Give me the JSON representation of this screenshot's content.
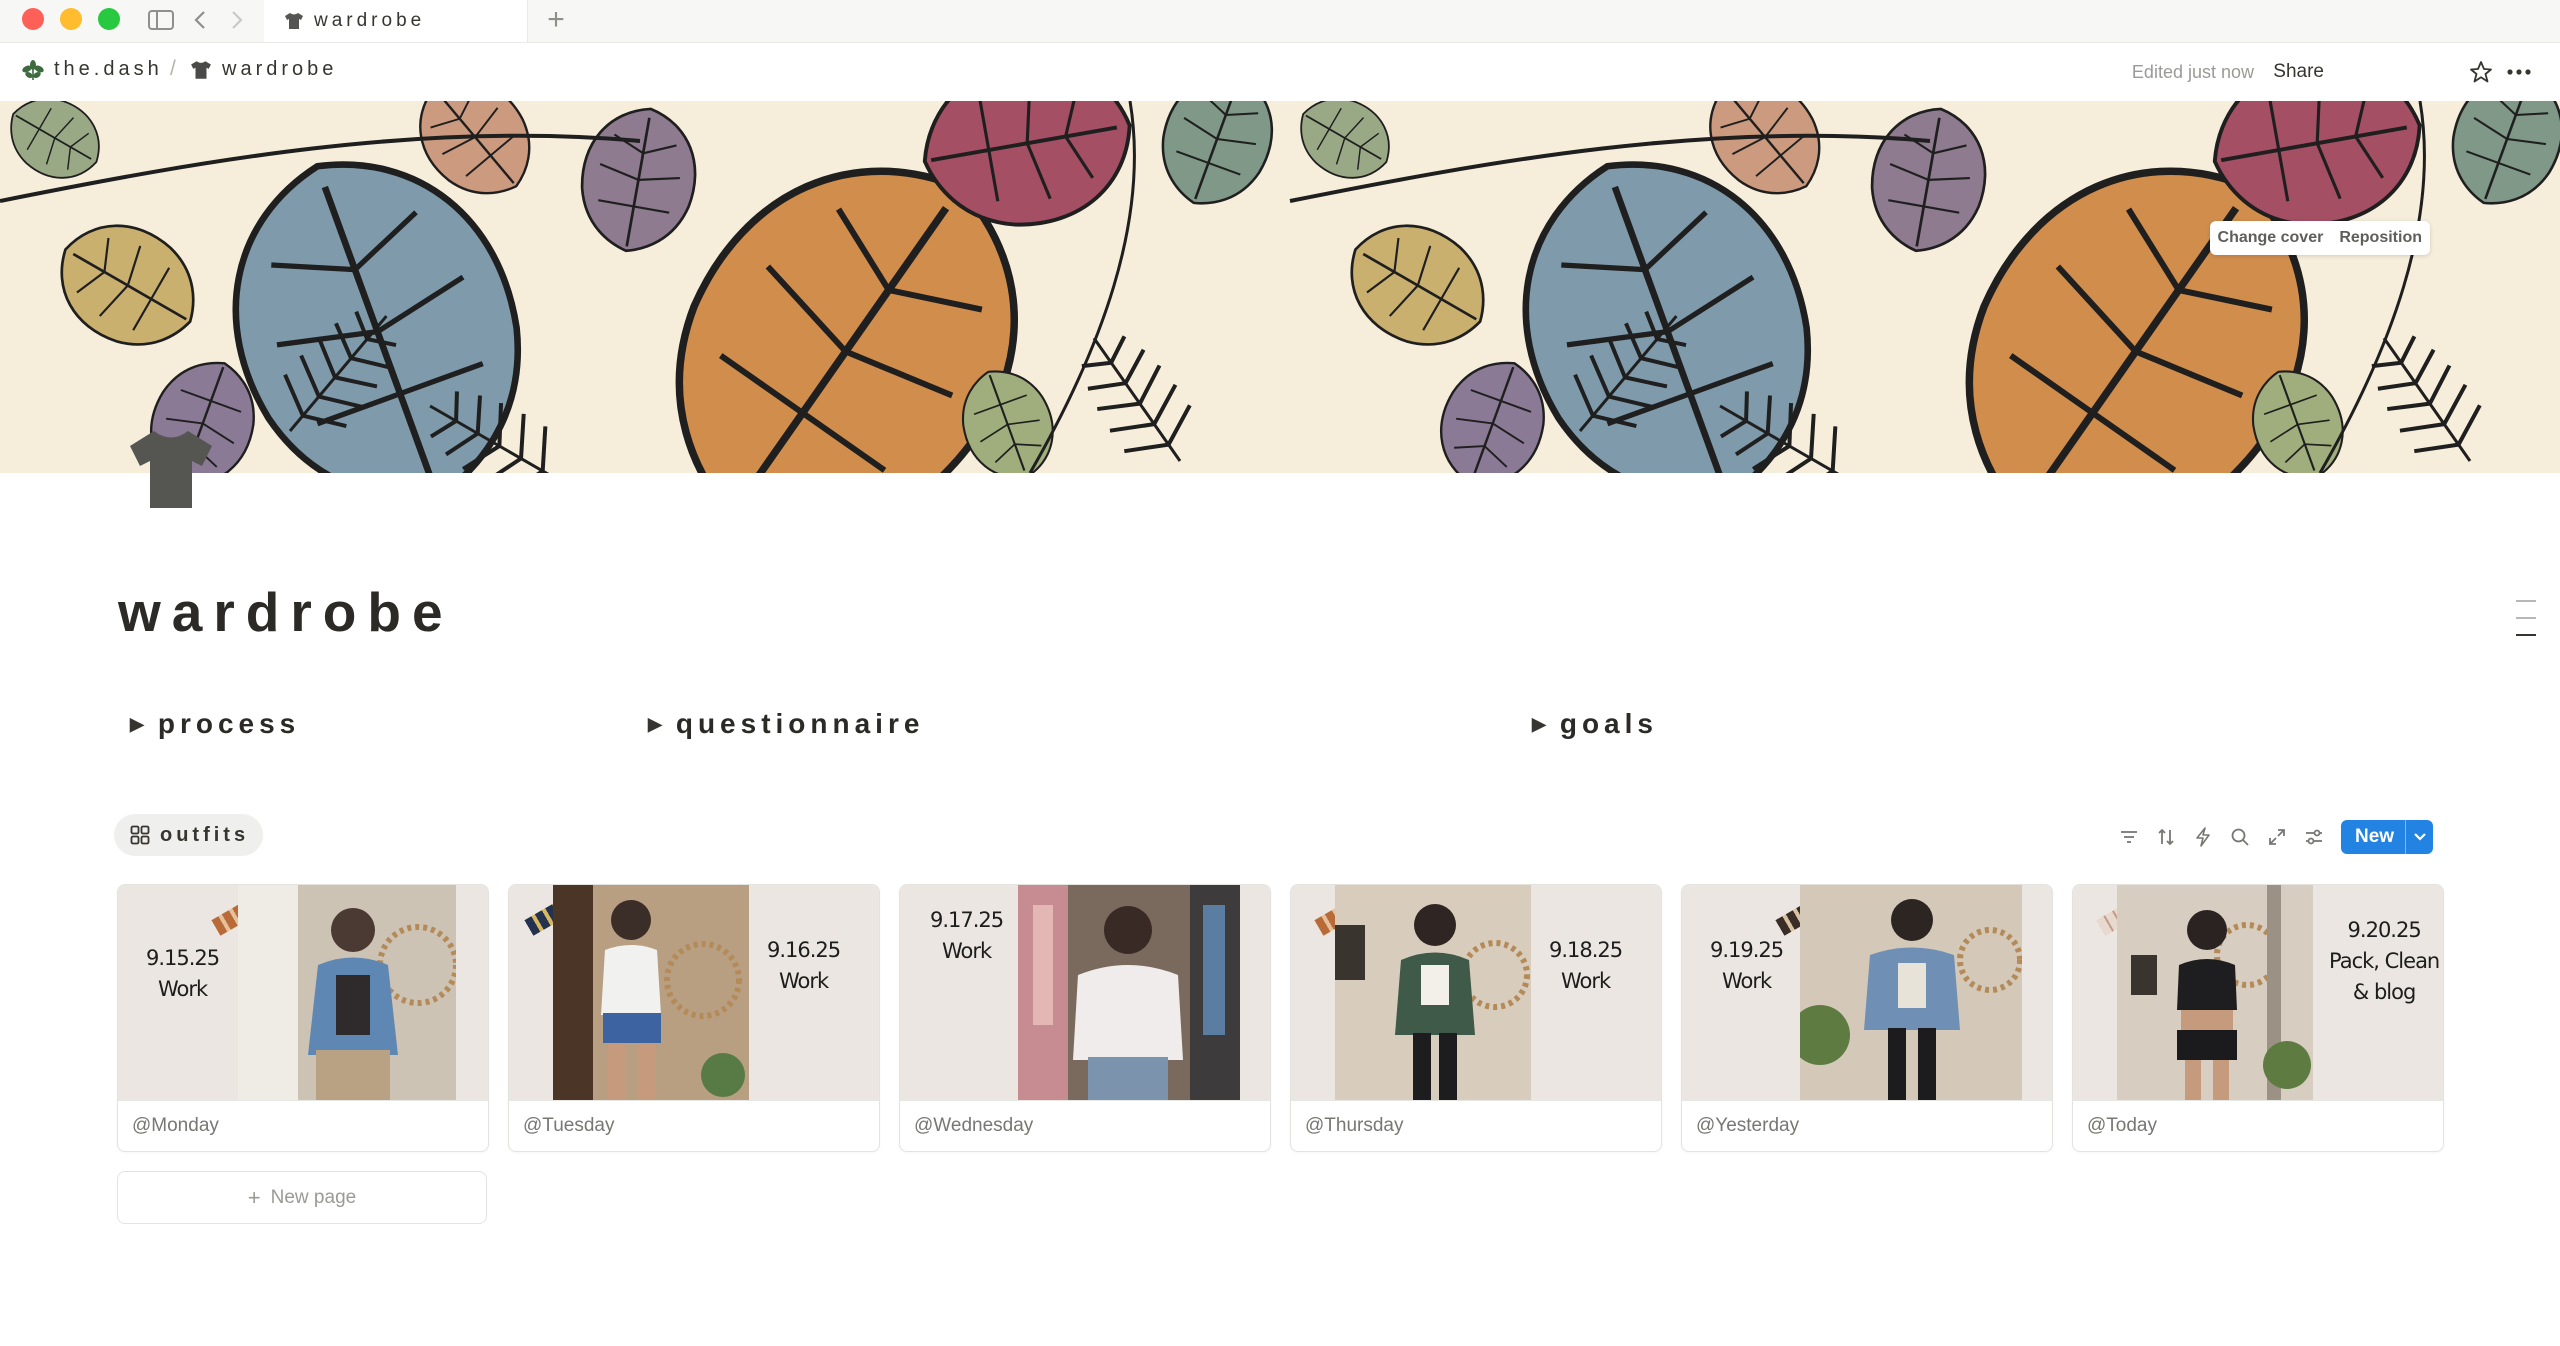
{
  "browser": {
    "tab_title": "wardrobe"
  },
  "topbar": {
    "breadcrumbs": [
      {
        "label": "the.dash",
        "icon": "plant-icon"
      },
      {
        "label": "wardrobe",
        "icon": "tshirt-icon"
      }
    ],
    "separator": "/",
    "edited": "Edited just now",
    "share": "Share"
  },
  "cover": {
    "change_cover": "Change cover",
    "reposition": "Reposition"
  },
  "page": {
    "icon": "tshirt-icon",
    "title": "wardrobe",
    "toggles": [
      "process",
      "questionnaire",
      "goals"
    ]
  },
  "database": {
    "view_tab": "outfits",
    "new_button": "New",
    "new_page": "New page",
    "cards": [
      {
        "date": "9.15.25",
        "note": "Work",
        "label": "@Monday"
      },
      {
        "date": "9.16.25",
        "note": "Work",
        "label": "@Tuesday"
      },
      {
        "date": "9.17.25",
        "note": "Work",
        "label": "@Wednesday"
      },
      {
        "date": "9.18.25",
        "note": "Work",
        "label": "@Thursday"
      },
      {
        "date": "9.19.25",
        "note": "Work",
        "label": "@Yesterday"
      },
      {
        "date": "9.20.25",
        "note": "Pack, Clean\n& blog",
        "label": "@Today"
      }
    ]
  },
  "colors": {
    "accent": "#2383e2",
    "text": "#37352f",
    "muted": "#9b9a97"
  }
}
